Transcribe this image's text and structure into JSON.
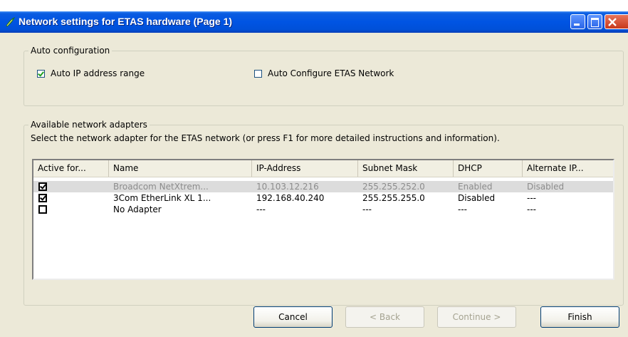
{
  "window": {
    "title": "Network settings for ETAS hardware (Page 1)"
  },
  "auto_config": {
    "legend": "Auto configuration",
    "auto_ip": {
      "label": "Auto IP address range",
      "checked": true
    },
    "auto_etas": {
      "label": "Auto Configure ETAS Network",
      "checked": false
    }
  },
  "adapters": {
    "legend": "Available network adapters",
    "instructions": "Select the network adapter for the ETAS network (or press F1 for more detailed instructions and information).",
    "columns": [
      "Active for...",
      "Name",
      "IP-Address",
      "Subnet Mask",
      "DHCP",
      "Alternate IP..."
    ],
    "rows": [
      {
        "active": true,
        "name": "Broadcom NetXtrem...",
        "ip": "10.103.12.216",
        "mask": "255.255.252.0",
        "dhcp": "Enabled",
        "alt": "Disabled",
        "selected": true
      },
      {
        "active": true,
        "name": "3Com EtherLink XL 1...",
        "ip": "192.168.40.240",
        "mask": "255.255.255.0",
        "dhcp": "Disabled",
        "alt": "---",
        "selected": false
      },
      {
        "active": false,
        "name": "No Adapter",
        "ip": "---",
        "mask": "---",
        "dhcp": "---",
        "alt": "---",
        "selected": false
      }
    ]
  },
  "buttons": {
    "cancel": "Cancel",
    "back": "< Back",
    "continue": "Continue >",
    "finish": "Finish"
  },
  "colors": {
    "titlebar": "#0054e3",
    "dialog_bg": "#ece9d8",
    "selected_row": "#dcdcdc"
  }
}
